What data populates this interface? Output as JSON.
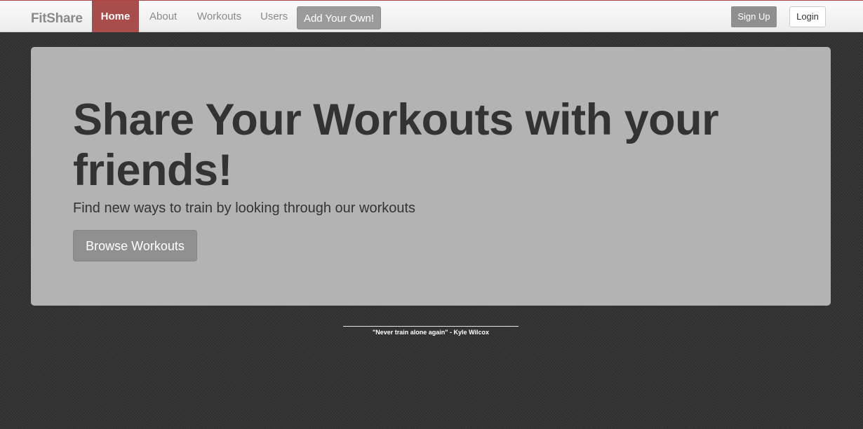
{
  "navbar": {
    "brand": "FitShare",
    "items": [
      {
        "label": "Home",
        "active": true
      },
      {
        "label": "About",
        "active": false
      },
      {
        "label": "Workouts",
        "active": false
      },
      {
        "label": "Users",
        "active": false
      }
    ],
    "add_button": "Add Your Own!",
    "signup_button": "Sign Up",
    "login_button": "Login",
    "accent_color": "#a94d4b"
  },
  "hero": {
    "title": "Share Your Workouts with your friends!",
    "subtitle": "Find new ways to train by looking through our workouts",
    "browse_button": "Browse Workouts"
  },
  "footer": {
    "quote": "\"Never train alone again\" - Kyle Wilcox"
  }
}
